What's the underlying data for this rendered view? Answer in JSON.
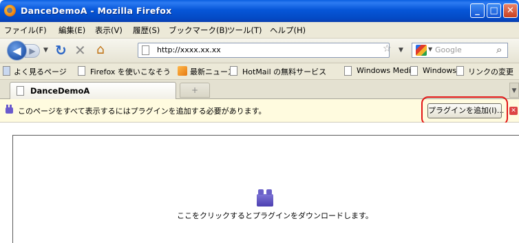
{
  "window": {
    "title": "DanceDemoA - Mozilla Firefox",
    "minimize": "_",
    "maximize": "□",
    "close": "✕"
  },
  "menu": [
    "ファイル(F)",
    "編集(E)",
    "表示(V)",
    "履歴(S)",
    "ブックマーク(B)",
    "ツール(T)",
    "ヘルプ(H)"
  ],
  "nav": {
    "url": "http://xxxx.xx.xx",
    "search_placeholder": "Google"
  },
  "bookmarks": [
    "よく見るページ",
    "Firefox を使いこなそう",
    "最新ニュース",
    "HotMail の無料サービス",
    "Windows Media",
    "Windows",
    "リンクの変更"
  ],
  "tabs": [
    {
      "label": "DanceDemoA"
    }
  ],
  "notification": {
    "message": "このページをすべて表示するにはプラグインを追加する必要があります。",
    "button_label": "プラグインを追加(I)..."
  },
  "content": {
    "download_message": "ここをクリックするとプラグインをダウンロードします。"
  },
  "colors": {
    "titlebar": "#0656d8",
    "notification_bg": "#fffbdf",
    "highlight": "#e21414"
  }
}
